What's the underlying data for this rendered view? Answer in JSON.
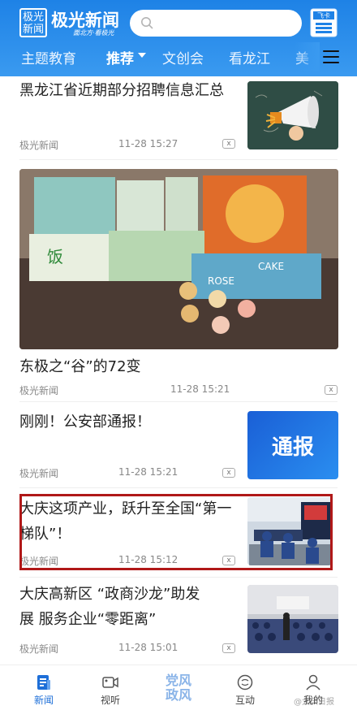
{
  "header": {
    "logo_box_line1": "极光",
    "logo_box_line2": "新闻",
    "logo_text": "极光新闻",
    "slogan": "面北方·看极光",
    "paper_button_label": "飞卡"
  },
  "tabs": [
    {
      "label": "主题教育",
      "active": false
    },
    {
      "label": "推荐",
      "active": true
    },
    {
      "label": "文创会",
      "active": false
    },
    {
      "label": "看龙江",
      "active": false
    },
    {
      "label": "美",
      "active": false
    }
  ],
  "news": [
    {
      "title_lines": [
        "黑龙江省近期部分招聘信息汇总"
      ],
      "source": "极光新闻",
      "time": "11-28 15:27",
      "close": "x"
    },
    {
      "title_lines": [
        "东极之“谷”的72变"
      ],
      "source": "极光新闻",
      "time": "11-28 15:21",
      "close": "x",
      "image_texts": [
        "ROSE",
        "CAKE"
      ]
    },
    {
      "title_lines": [
        "刚刚！公安部通报！"
      ],
      "source": "极光新闻",
      "time": "11-28 15:21",
      "close": "x",
      "image_text": "通报"
    },
    {
      "title_lines": [
        "大庆这项产业，跃升至全国“第一",
        "梯队”！"
      ],
      "source": "极光新闻",
      "time": "11-28 15:12",
      "close": "x"
    },
    {
      "title_lines": [
        "大庆高新区 “政商沙龙”助发",
        "展 服务企业“零距离”"
      ],
      "source": "极光新闻",
      "time": "11-28 15:01",
      "close": "x"
    }
  ],
  "bottom_nav": [
    {
      "label": "新闻",
      "icon": "news-icon",
      "active": true
    },
    {
      "label": "视听",
      "icon": "video-icon",
      "active": false
    },
    {
      "label_line1": "党风",
      "label_line2": "政风"
    },
    {
      "label": "互动",
      "icon": "chat-icon",
      "active": false
    },
    {
      "label": "我的",
      "icon": "user-icon",
      "active": false
    }
  ],
  "watermark": "@大庆日报",
  "colors": {
    "brand": "#1e82e6",
    "highlight": "#b01818"
  }
}
